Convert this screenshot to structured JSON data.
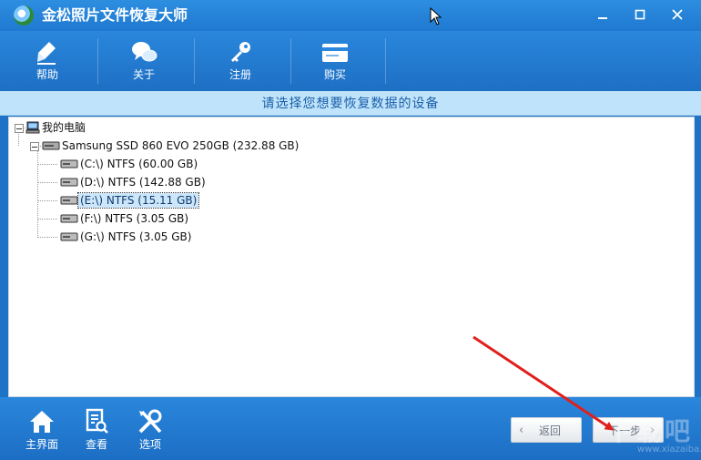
{
  "app": {
    "title": "金松照片文件恢复大师"
  },
  "toolbar": {
    "items": [
      {
        "label": "帮助"
      },
      {
        "label": "关于"
      },
      {
        "label": "注册"
      },
      {
        "label": "购买"
      }
    ]
  },
  "subheader": {
    "text": "请选择您想要恢复数据的设备"
  },
  "tree": {
    "root": "我的电脑",
    "disk": "Samsung SSD 860 EVO 250GB (232.88 GB)",
    "partitions": [
      {
        "label": "(C:\\) NTFS (60.00 GB)"
      },
      {
        "label": "(D:\\) NTFS (142.88 GB)"
      },
      {
        "label": "(E:\\) NTFS (15.11 GB)",
        "selected": true
      },
      {
        "label": "(F:\\) NTFS (3.05 GB)"
      },
      {
        "label": "(G:\\) NTFS (3.05 GB)"
      }
    ]
  },
  "bottombar": {
    "items": [
      {
        "label": "主界面"
      },
      {
        "label": "查看"
      },
      {
        "label": "选项"
      }
    ]
  },
  "nav": {
    "back": "返回",
    "next": "下一步"
  },
  "watermark": {
    "cn": "下载吧",
    "en": "www.xiazaiba.com"
  },
  "colors": {
    "title_bar": "#1f79d0",
    "subheader_bg": "#bfe3fb",
    "arrow": "#e0201c",
    "selection": "#cde6fa"
  }
}
